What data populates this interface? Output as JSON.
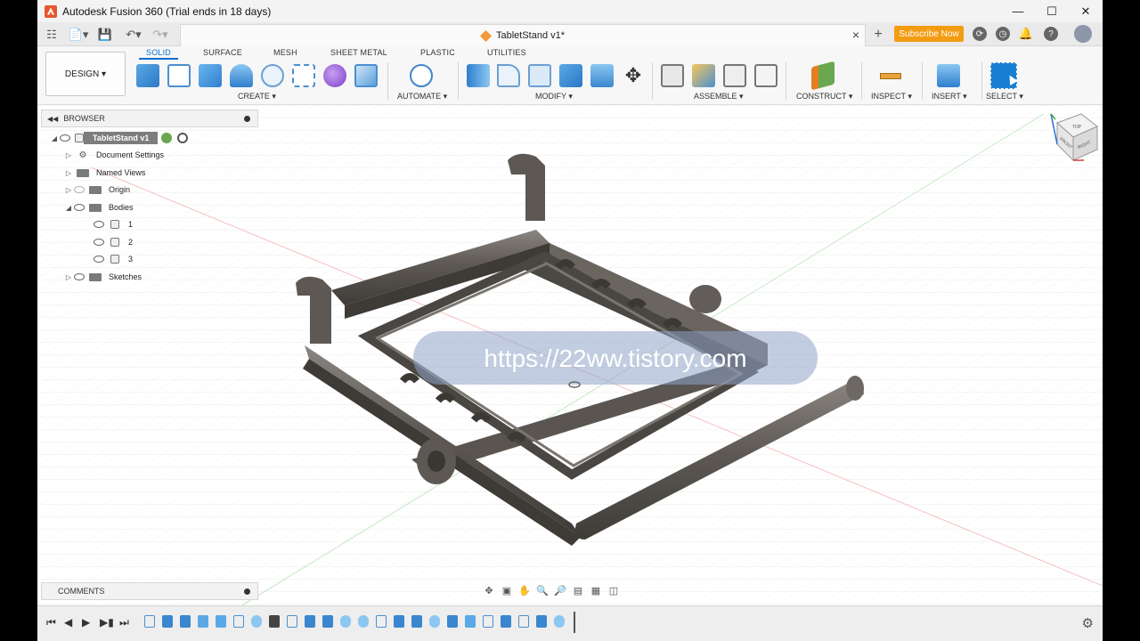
{
  "titlebar": {
    "title": "Autodesk Fusion 360 (Trial ends in 18 days)",
    "controls": [
      "minimize",
      "maximize",
      "close"
    ]
  },
  "tabbar": {
    "document_tab": "TabletStand v1*",
    "subscribe_label": "Subscribe Now",
    "icons": [
      "grid-icon",
      "file-icon",
      "save-icon",
      "undo-icon",
      "redo-icon",
      "add-tab-icon",
      "online-icon",
      "clock-icon",
      "bell-icon",
      "help-icon",
      "avatar"
    ]
  },
  "ribbon": {
    "workspace": "DESIGN ▾",
    "tabs": [
      {
        "label": "SOLID",
        "active": true
      },
      {
        "label": "SURFACE",
        "active": false
      },
      {
        "label": "MESH",
        "active": false
      },
      {
        "label": "SHEET METAL",
        "active": false
      },
      {
        "label": "PLASTIC",
        "active": false
      },
      {
        "label": "UTILITIES",
        "active": false
      }
    ],
    "groups": {
      "create": "CREATE ▾",
      "automate": "AUTOMATE ▾",
      "modify": "MODIFY ▾",
      "assemble": "ASSEMBLE ▾",
      "construct": "CONSTRUCT ▾",
      "inspect": "INSPECT ▾",
      "insert": "INSERT ▾",
      "select": "SELECT ▾"
    }
  },
  "browser": {
    "title": "BROWSER",
    "root": "TabletStand v1",
    "items": [
      {
        "label": "Document Settings"
      },
      {
        "label": "Named Views"
      },
      {
        "label": "Origin"
      },
      {
        "label": "Bodies"
      },
      {
        "label": "1"
      },
      {
        "label": "2"
      },
      {
        "label": "3"
      },
      {
        "label": "Sketches"
      }
    ]
  },
  "watermark": "https://22ww.tistory.com",
  "comments": {
    "title": "COMMENTS"
  },
  "viewcube": {
    "faces": [
      "TOP",
      "FRONT",
      "RIGHT"
    ]
  },
  "colors": {
    "accent": "#0a6ed1",
    "subscribe": "#f39c12",
    "model": "#5f5a55"
  }
}
